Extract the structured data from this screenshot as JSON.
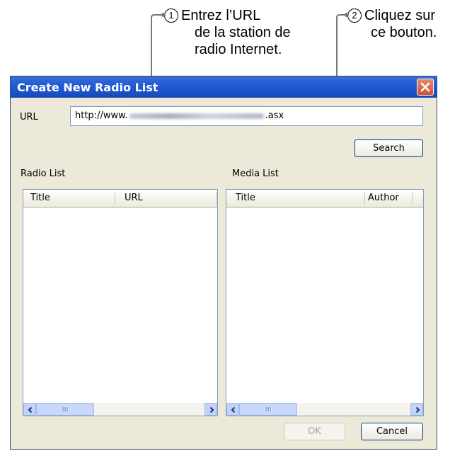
{
  "callouts": [
    {
      "number": "1",
      "lines": [
        "Entrez l’URL",
        "de la station de",
        "radio Internet."
      ]
    },
    {
      "number": "2",
      "lines": [
        "Cliquez sur",
        "ce bouton."
      ]
    }
  ],
  "window": {
    "title": "Create New Radio List",
    "close_icon": "close-x-icon",
    "url_label": "URL",
    "url_value_prefix": "http://www.",
    "url_value_suffix": ".asx",
    "search_button": "Search",
    "radio_list": {
      "label": "Radio List",
      "columns": [
        "Title",
        "URL"
      ]
    },
    "media_list": {
      "label": "Media List",
      "columns": [
        "Title",
        "Author"
      ]
    },
    "ok_button": "OK",
    "cancel_button": "Cancel"
  },
  "colors": {
    "titlebar": "#245ed8",
    "dialog_bg": "#ece9d8",
    "close_button": "#d4502e"
  }
}
